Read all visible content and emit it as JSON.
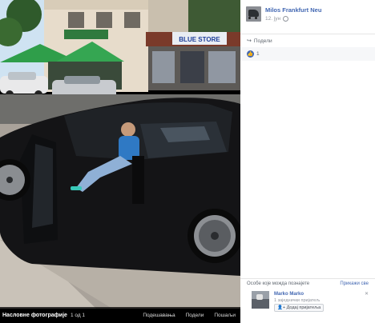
{
  "post": {
    "author": "Milos Frankfurt Neu",
    "date": "12. јун"
  },
  "actions": {
    "share": "Подели"
  },
  "reactions": {
    "count": "1"
  },
  "photo": {
    "store_sign": "BLUE STORE"
  },
  "viewer": {
    "album_title": "Насловне фотографије",
    "count": "1 од 1",
    "tag": "Подешавања",
    "share": "Подели",
    "send": "Пошаљи"
  },
  "pymk": {
    "heading": "Особе које можда познајете",
    "see_all": "Прикажи све",
    "name": "Marko Marko",
    "mutual": "1 заједнички пријатељ",
    "add_button": "Додај пријатеља"
  },
  "colors": {
    "link": "#4267b2",
    "panel_bg": "#ffffff",
    "viewer_bg": "#000000"
  }
}
